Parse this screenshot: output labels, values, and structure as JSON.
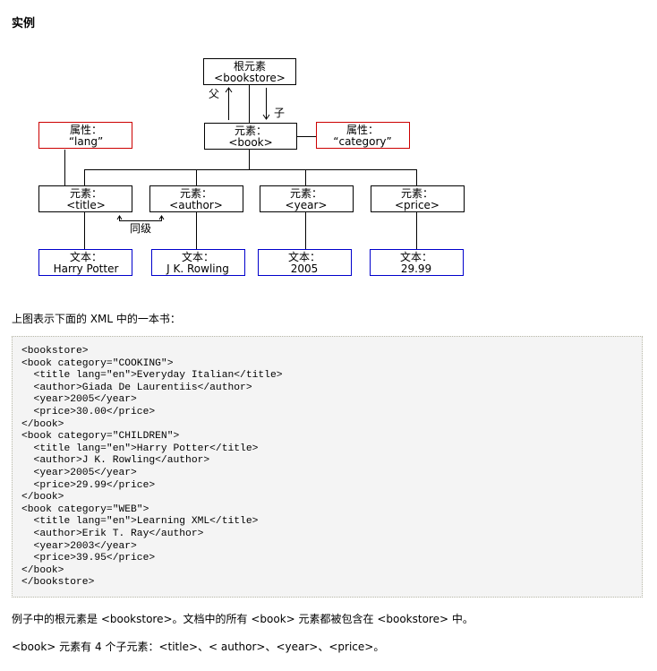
{
  "heading": "实例",
  "diagram": {
    "root": {
      "label": "根元素",
      "tag": "<bookstore>"
    },
    "book": {
      "label": "元素：",
      "tag": "<book>"
    },
    "attr_lang": {
      "label": "属性：",
      "value": "“lang”"
    },
    "attr_category": {
      "label": "属性：",
      "value": "“category”"
    },
    "parent_label": "父",
    "child_label": "子",
    "sibling_label": "同级",
    "elements": [
      {
        "label": "元素：",
        "tag": "<title>"
      },
      {
        "label": "元素：",
        "tag": "<author>"
      },
      {
        "label": "元素：",
        "tag": "<year>"
      },
      {
        "label": "元素：",
        "tag": "<price>"
      }
    ],
    "texts": [
      {
        "label": "文本：",
        "value": "Harry Potter"
      },
      {
        "label": "文本：",
        "value": "J K. Rowling"
      },
      {
        "label": "文本：",
        "value": "2005"
      },
      {
        "label": "文本：",
        "value": "29.99"
      }
    ],
    "colors": {
      "element_border": "#000000",
      "attribute_border": "#cc0000",
      "text_border": "#0000cc"
    }
  },
  "intro": "上图表示下面的 XML 中的一本书：",
  "code": "<bookstore>\n<book category=\"COOKING\">\n  <title lang=\"en\">Everyday Italian</title>\n  <author>Giada De Laurentiis</author>\n  <year>2005</year>\n  <price>30.00</price>\n</book>\n<book category=\"CHILDREN\">\n  <title lang=\"en\">Harry Potter</title>\n  <author>J K. Rowling</author>\n  <year>2005</year>\n  <price>29.99</price>\n</book>\n<book category=\"WEB\">\n  <title lang=\"en\">Learning XML</title>\n  <author>Erik T. Ray</author>\n  <year>2003</year>\n  <price>39.95</price>\n</book>\n</bookstore>",
  "para1": "例子中的根元素是 <bookstore>。文档中的所有 <book> 元素都被包含在 <bookstore> 中。",
  "para2": "<book> 元素有 4 个子元素：<title>、< author>、<year>、<price>。"
}
